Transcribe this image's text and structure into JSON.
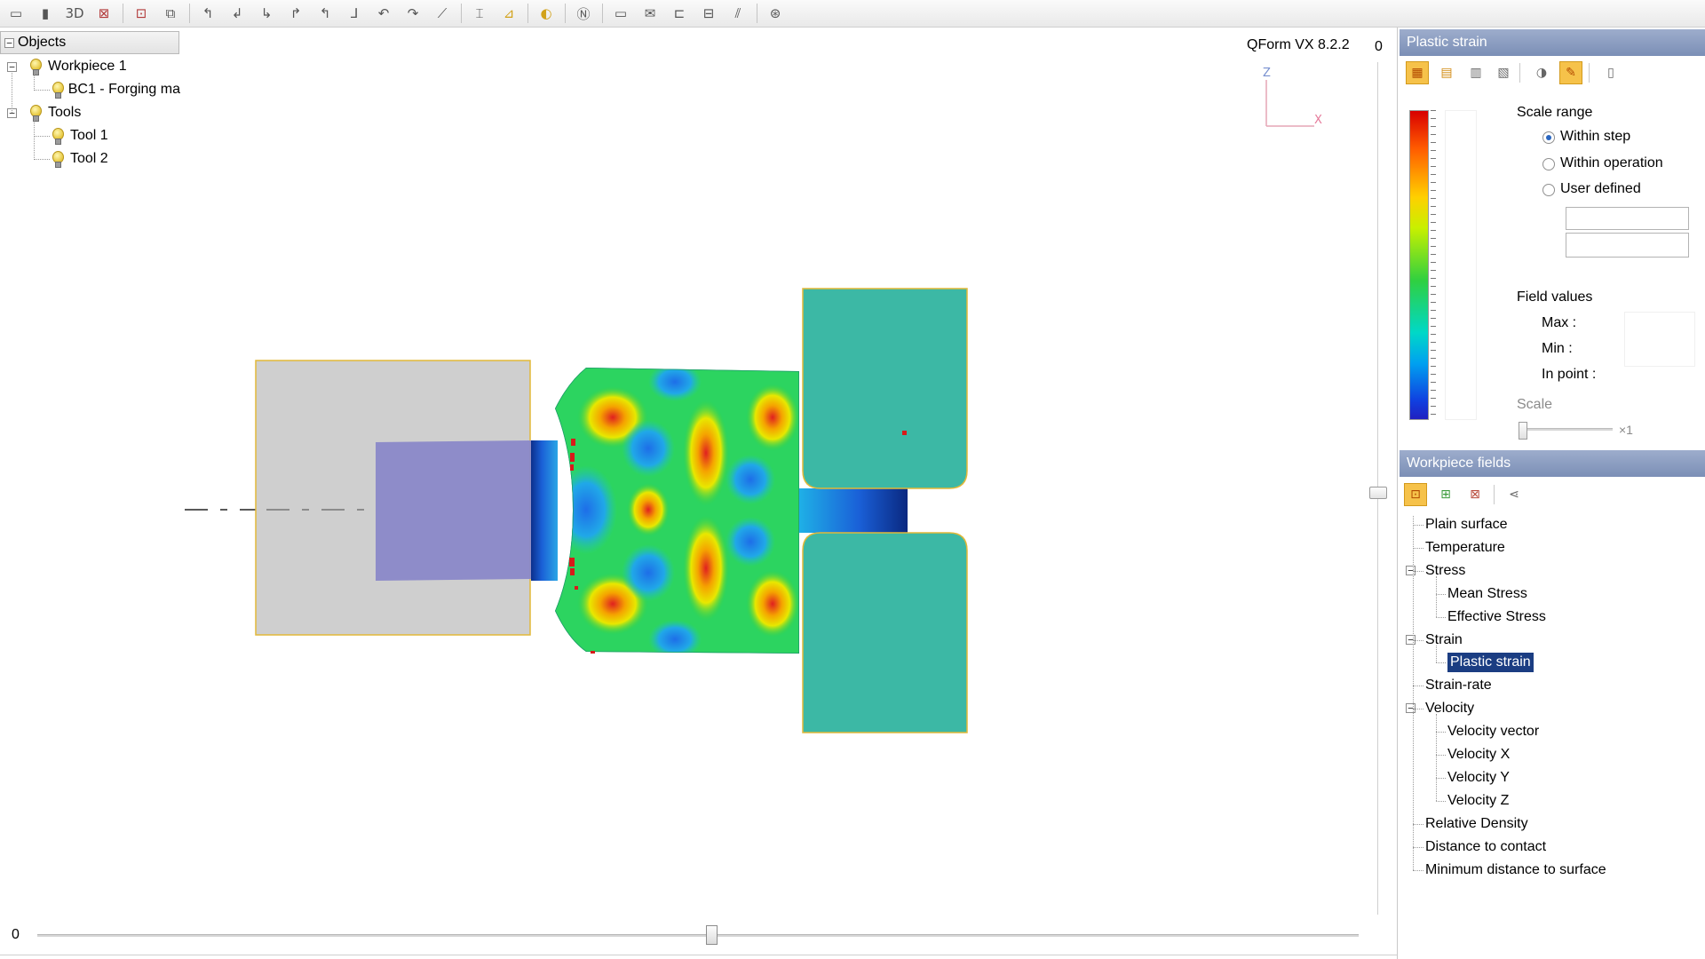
{
  "toolbar": {
    "icons": [
      {
        "name": "new-project-icon",
        "glyph": "▭"
      },
      {
        "name": "open-project-icon",
        "glyph": "▮"
      },
      {
        "name": "view-3d-icon",
        "glyph": "3D"
      },
      {
        "name": "tool-red-icon",
        "glyph": "⊠"
      },
      {
        "name": "workpiece-red-icon",
        "glyph": "⊡"
      },
      {
        "name": "export-icon",
        "glyph": "⧉"
      },
      {
        "name": "axis-x-icon",
        "glyph": "↰"
      },
      {
        "name": "axis-y-icon",
        "glyph": "↲"
      },
      {
        "name": "axis-z-icon",
        "glyph": "↳"
      },
      {
        "name": "axis-xy-icon",
        "glyph": "↱"
      },
      {
        "name": "axis-yz-icon",
        "glyph": "↰"
      },
      {
        "name": "axis-xz-icon",
        "glyph": "⅃"
      },
      {
        "name": "axis-rotate-icon",
        "glyph": "↶"
      },
      {
        "name": "axis-reset-icon",
        "glyph": "↷"
      },
      {
        "name": "ruler-icon",
        "glyph": "⟋"
      },
      {
        "name": "fit-icon",
        "glyph": "⌶"
      },
      {
        "name": "section-icon",
        "glyph": "⊿"
      },
      {
        "name": "shading-icon",
        "glyph": "◐"
      },
      {
        "name": "navigator-icon",
        "glyph": "Ⓝ"
      },
      {
        "name": "window-icon",
        "glyph": "▭"
      },
      {
        "name": "mail-icon",
        "glyph": "✉"
      },
      {
        "name": "frame-icon",
        "glyph": "⊏"
      },
      {
        "name": "film-icon",
        "glyph": "⊟"
      },
      {
        "name": "chart-icon",
        "glyph": "⫽"
      },
      {
        "name": "report-icon",
        "glyph": "⊛"
      }
    ]
  },
  "objects": {
    "header": "Objects",
    "items": [
      {
        "label": "Workpiece 1",
        "level": 0,
        "expander": "-"
      },
      {
        "label": "BC1 - Forging ma",
        "level": 1,
        "expander": ""
      },
      {
        "label": "Tools",
        "level": 0,
        "expander": "-"
      },
      {
        "label": "Tool 1",
        "level": 1,
        "expander": ""
      },
      {
        "label": "Tool 2",
        "level": 1,
        "expander": ""
      }
    ]
  },
  "viewport": {
    "version": "QForm VX 8.2.2",
    "step_counter": "0",
    "axis_z": "Z",
    "axis_x": "X",
    "time_value": "0",
    "time_position": 0.51
  },
  "plastic_strain_panel": {
    "title": "Plastic strain",
    "scale_range_label": "Scale range",
    "options": [
      {
        "label": "Within step",
        "checked": true
      },
      {
        "label": "Within operation",
        "checked": false
      },
      {
        "label": "User defined",
        "checked": false
      }
    ],
    "field_values_label": "Field values",
    "max_label": "Max :",
    "min_label": "Min :",
    "in_point_label": "In point :",
    "scale_label": "Scale",
    "scale_multiplier": "×1"
  },
  "workpiece_fields_panel": {
    "title": "Workpiece fields",
    "items": [
      {
        "label": "Plain surface",
        "level": 0
      },
      {
        "label": "Temperature",
        "level": 0
      },
      {
        "label": "Stress",
        "level": 0,
        "expander": "-"
      },
      {
        "label": "Mean Stress",
        "level": 1
      },
      {
        "label": "Effective Stress",
        "level": 1
      },
      {
        "label": "Strain",
        "level": 0,
        "expander": "-"
      },
      {
        "label": "Plastic strain",
        "level": 1,
        "selected": true
      },
      {
        "label": "Strain-rate",
        "level": 0
      },
      {
        "label": "Velocity",
        "level": 0,
        "expander": "-"
      },
      {
        "label": "Velocity vector",
        "level": 1
      },
      {
        "label": "Velocity X",
        "level": 1
      },
      {
        "label": "Velocity Y",
        "level": 1
      },
      {
        "label": "Velocity Z",
        "level": 1
      },
      {
        "label": "Relative Density",
        "level": 0
      },
      {
        "label": "Distance to contact",
        "level": 0
      },
      {
        "label": "Minimum distance to surface",
        "level": 0
      }
    ]
  },
  "colors": {
    "tool": "#3cb8a5",
    "container": "#cfcfcf",
    "punch": "#8a88c8",
    "panel_header": "#8a9bc0",
    "selection": "#1b3d82"
  }
}
